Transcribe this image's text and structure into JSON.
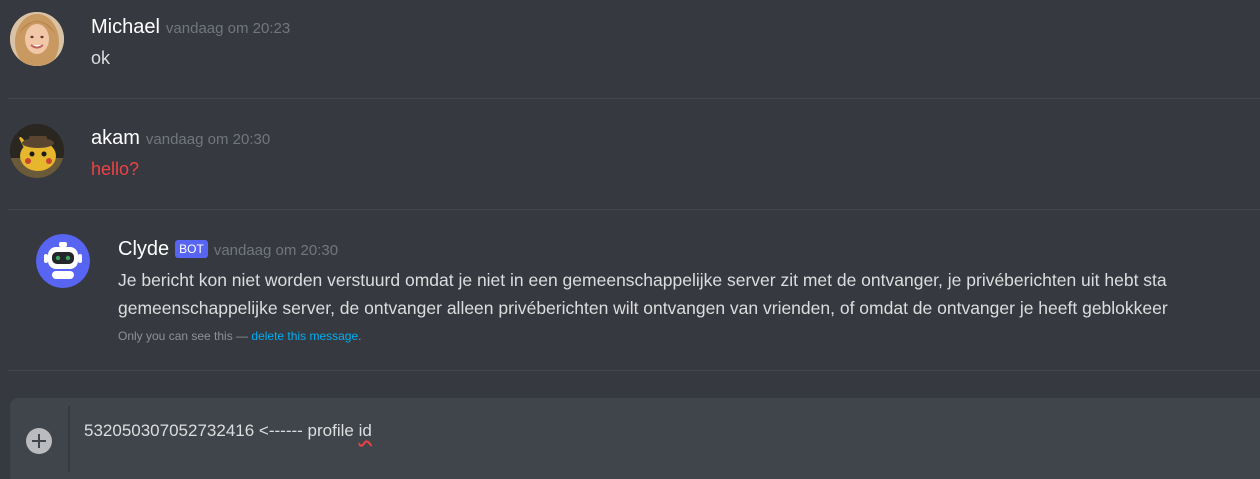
{
  "messages": [
    {
      "username": "Michael",
      "timestamp": "vandaag om 20:23",
      "content": "ok",
      "avatar": "woman-portrait-avatar"
    },
    {
      "username": "akam",
      "timestamp": "vandaag om 20:30",
      "content": "hello?",
      "content_color": "#ed4245",
      "avatar": "pikachu-detective-avatar"
    },
    {
      "username": "Clyde",
      "badge": "BOT",
      "timestamp": "vandaag om 20:30",
      "content_line1": "Je bericht kon niet worden verstuurd omdat je niet in een gemeenschappelijke server zit met de ontvanger, je privéberichten uit hebt sta",
      "content_line2": "gemeenschappelijke server, de ontvanger alleen privéberichten wilt ontvangen van vrienden, of omdat de ontvanger je heeft geblokkeer",
      "ephemeral_prefix": "Only you can see this — ",
      "ephemeral_link": "delete this message",
      "ephemeral_suffix": ".",
      "avatar": "clyde-bot-avatar"
    }
  ],
  "composer": {
    "text_prefix": "532050307052732416  <------ profile ",
    "text_misspelled": "id"
  },
  "colors": {
    "background": "#36393f",
    "composer": "#40444b",
    "bot_badge": "#5865f2",
    "link": "#00aff4",
    "error_text": "#ed4245"
  }
}
